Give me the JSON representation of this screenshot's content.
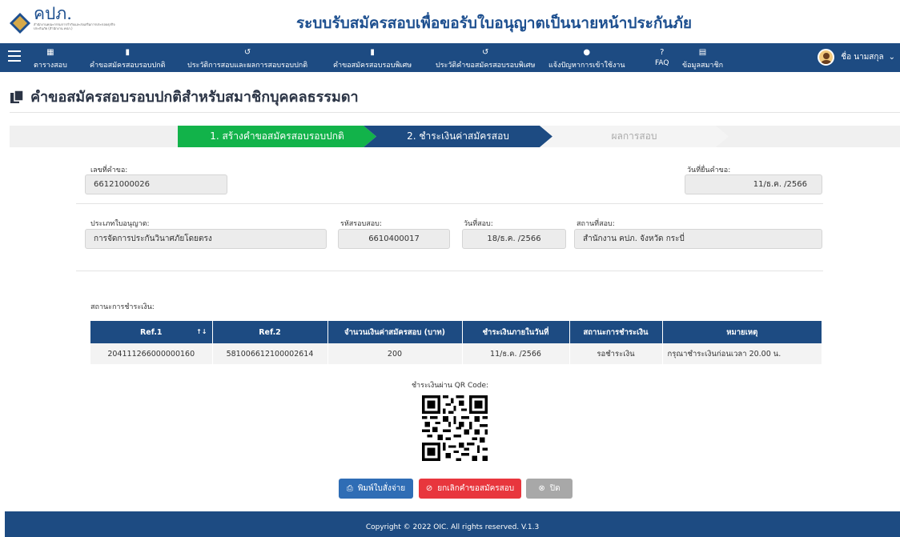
{
  "header": {
    "logo_text": "คปภ.",
    "logo_subtext": "สำนักงานคณะกรรมการกำกับและส่งเสริมการประกอบธุรกิจประกันภัย (สำนักงาน คปภ.)",
    "site_title": "ระบบรับสมัครสอบเพื่อขอรับใบอนุญาตเป็นนายหน้าประกันภัย"
  },
  "nav": {
    "items": [
      {
        "label": "ตารางสอบ",
        "icon": "calendar-icon"
      },
      {
        "label": "คำขอสมัครสอบรอบปกติ",
        "icon": "document-icon"
      },
      {
        "label": "ประวัติการสอบและผลการสอบรอบปกติ",
        "icon": "history-icon"
      },
      {
        "label": "คำขอสมัครสอบรอบพิเศษ",
        "icon": "document-icon"
      },
      {
        "label": "ประวัติคำขอสมัครสอบรอบพิเศษ",
        "icon": "history-icon"
      },
      {
        "label": "แจ้งปัญหาการเข้าใช้งาน",
        "icon": "chat-icon"
      },
      {
        "label": "FAQ",
        "icon": "question-icon"
      },
      {
        "label": "ข้อมูลสมาชิก",
        "icon": "id-card-icon"
      }
    ],
    "user_name": "ชื่อ นามสกุล"
  },
  "page": {
    "title": "คำขอสมัครสอบรอบปกติสำหรับสมาชิกบุคคลธรรมดา"
  },
  "steps": {
    "step1": "1. สร้างคำขอสมัครสอบรอบปกติ",
    "step2": "2. ชำระเงินค่าสมัครสอบ",
    "step3": "ผลการสอบ"
  },
  "form": {
    "request_no_label": "เลขที่คำขอ:",
    "request_no": "66121000026",
    "submit_date_label": "วันที่ยื่นคำขอ:",
    "submit_date": "11/ธ.ค. /2566",
    "license_type_label": "ประเภทใบอนุญาต:",
    "license_type": "การจัดการประกันวินาศภัยโดยตรง",
    "exam_code_label": "รหัสรอบสอบ:",
    "exam_code": "6610400017",
    "exam_date_label": "วันที่สอบ:",
    "exam_date": "18/ธ.ค. /2566",
    "exam_place_label": "สถานที่สอบ:",
    "exam_place": "สำนักงาน คปภ. จังหวัด กระบี่",
    "payment_status_label": "สถานะการชำระเงิน:"
  },
  "payment_table": {
    "headers": [
      "Ref.1",
      "Ref.2",
      "จำนวนเงินค่าสมัครสอบ (บาท)",
      "ชำระเงินภายในวันที่",
      "สถานะการชำระเงิน",
      "หมายเหตุ"
    ],
    "rows": [
      [
        "204111266000000160",
        "581006612100002614",
        "200",
        "11/ธ.ค. /2566",
        "รอชำระเงิน",
        "กรุณาชำระเงินก่อนเวลา 20.00 น."
      ]
    ]
  },
  "qr": {
    "label": "ชำระเงินผ่าน QR Code:"
  },
  "buttons": {
    "print": "พิมพ์ใบสั่งจ่าย",
    "cancel": "ยกเลิกคำขอสมัครสอบ",
    "close": "ปิด"
  },
  "footer": {
    "copyright": "Copyright © 2022 OIC. All rights reserved. V.1.3"
  },
  "colors": {
    "navy": "#1d4b82",
    "green": "#12b34a",
    "red": "#e8363d",
    "blue_button": "#2f6db5"
  }
}
